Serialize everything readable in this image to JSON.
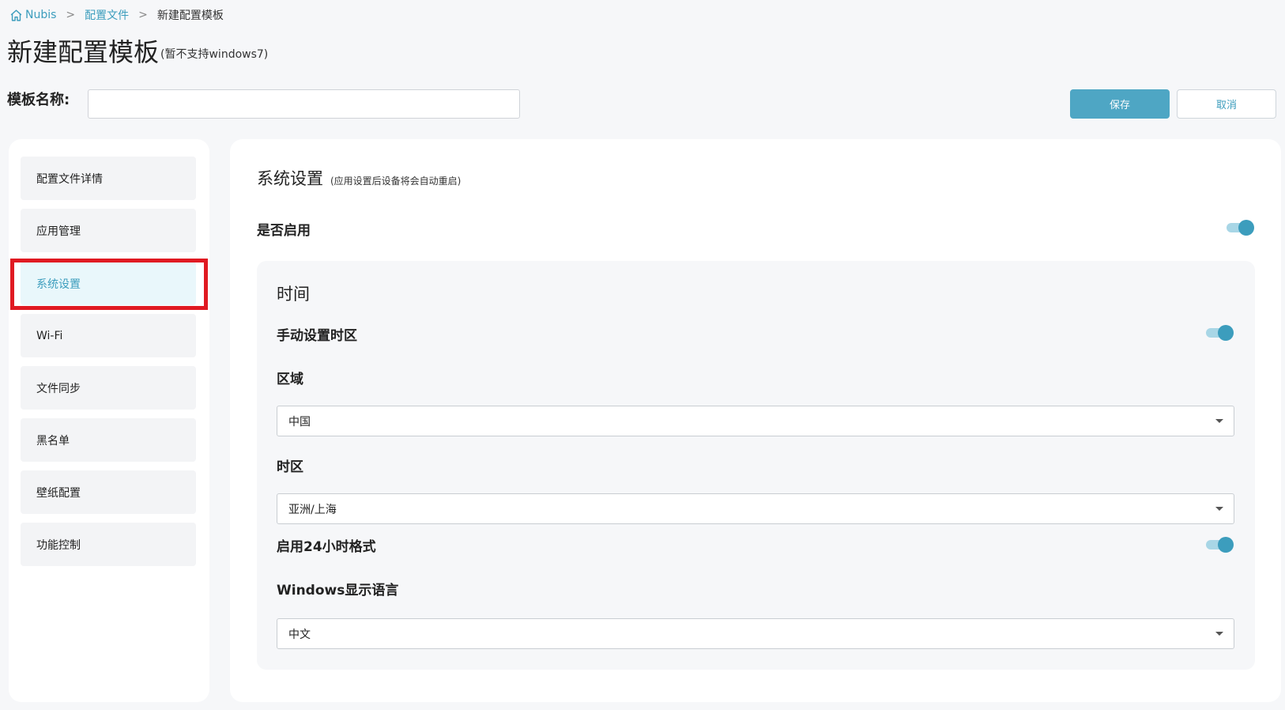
{
  "breadcrumb": {
    "home": "Nubis",
    "level1": "配置文件",
    "current": "新建配置模板",
    "separator": ">"
  },
  "page": {
    "title": "新建配置模板",
    "subtitle": "(暂不支持windows7)"
  },
  "template_name": {
    "label": "模板名称:",
    "value": "",
    "placeholder": ""
  },
  "actions": {
    "save": "保存",
    "cancel": "取消"
  },
  "sidebar": {
    "items": [
      {
        "label": "配置文件详情",
        "active": false
      },
      {
        "label": "应用管理",
        "active": false
      },
      {
        "label": "系统设置",
        "active": true
      },
      {
        "label": "Wi-Fi",
        "active": false
      },
      {
        "label": "文件同步",
        "active": false
      },
      {
        "label": "黑名单",
        "active": false
      },
      {
        "label": "壁纸配置",
        "active": false
      },
      {
        "label": "功能控制",
        "active": false
      }
    ]
  },
  "system_settings": {
    "title": "系统设置",
    "note": "(应用设置后设备将会自动重启)",
    "enable_label": "是否启用",
    "enabled": true,
    "time": {
      "title": "时间",
      "manual_tz_label": "手动设置时区",
      "manual_tz_enabled": true,
      "region_label": "区域",
      "region_value": "中国",
      "timezone_label": "时区",
      "timezone_value": "亚洲/上海",
      "hour24_label": "启用24小时格式",
      "hour24_enabled": true,
      "language_label": "Windows显示语言",
      "language_value": "中文"
    }
  },
  "colors": {
    "accent": "#3c9dbd",
    "save_button": "#4ea6c4",
    "highlight": "#e01a22",
    "toggle_track": "#a8d6e6"
  }
}
